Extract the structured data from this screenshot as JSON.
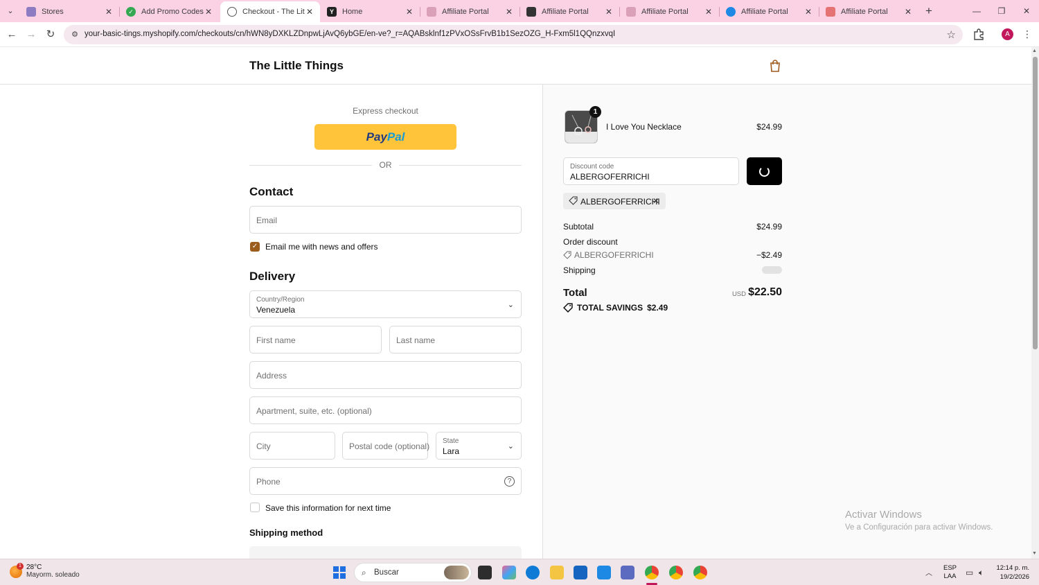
{
  "browser": {
    "tabs": [
      {
        "title": "Stores",
        "favicon": "stores-favicon",
        "color": "#8e7cc3",
        "active": false
      },
      {
        "title": "Add Promo Codes fo",
        "favicon": "promo-favicon",
        "color": "#34a853",
        "active": false
      },
      {
        "title": "Checkout - The Little",
        "favicon": "shopify-favicon",
        "color": "#555555",
        "active": true
      },
      {
        "title": "Home",
        "favicon": "y-favicon",
        "color": "#222222",
        "active": false
      },
      {
        "title": "Affiliate Portal",
        "favicon": "affiliate-favicon-1",
        "color": "#d9a0b8",
        "active": false
      },
      {
        "title": "Affiliate Portal",
        "favicon": "affiliate-favicon-2",
        "color": "#333333",
        "active": false
      },
      {
        "title": "Affiliate Portal",
        "favicon": "affiliate-favicon-3",
        "color": "#d9a0b8",
        "active": false
      },
      {
        "title": "Affiliate Portal",
        "favicon": "affiliate-favicon-4",
        "color": "#1e88e5",
        "active": false
      },
      {
        "title": "Affiliate Portal",
        "favicon": "affiliate-favicon-5",
        "color": "#e57373",
        "active": false
      }
    ],
    "url": "your-basic-tings.myshopify.com/checkouts/cn/hWN8yDXKLZDnpwLjAvQ6ybGE/en-ve?_r=AQABsklnf1zPVxOSsFrvB1b1SezOZG_H-Fxm5l1QQnzxvqI",
    "profile_initial": "A"
  },
  "store": {
    "name": "The Little Things"
  },
  "checkout": {
    "express_label": "Express checkout",
    "paypal_pay": "Pay",
    "paypal_pal": "Pal",
    "or_label": "OR",
    "contact_title": "Contact",
    "email_placeholder": "Email",
    "news_checkbox_label": "Email me with news and offers",
    "news_checkbox_checked": true,
    "delivery_title": "Delivery",
    "country_label": "Country/Region",
    "country_value": "Venezuela",
    "first_name_placeholder": "First name",
    "last_name_placeholder": "Last name",
    "address_placeholder": "Address",
    "apartment_placeholder": "Apartment, suite, etc. (optional)",
    "city_placeholder": "City",
    "postal_placeholder": "Postal code (optional)",
    "state_label": "State",
    "state_value": "Lara",
    "phone_placeholder": "Phone",
    "save_info_label": "Save this information for next time",
    "save_info_checked": false,
    "shipping_method_title": "Shipping method"
  },
  "summary": {
    "product": {
      "name": "I Love You Necklace",
      "price": "$24.99",
      "quantity": "1"
    },
    "discount_label": "Discount code",
    "discount_value": "ALBERGOFERRICHI",
    "applied_code": "ALBERGOFERRICHI",
    "subtotal_label": "Subtotal",
    "subtotal_value": "$24.99",
    "order_discount_label": "Order discount",
    "order_discount_code": "ALBERGOFERRICHI",
    "order_discount_value": "−$2.49",
    "shipping_label": "Shipping",
    "total_label": "Total",
    "total_currency": "USD",
    "total_value": "$22.50",
    "savings_label": "TOTAL SAVINGS",
    "savings_value": "$2.49"
  },
  "watermark": {
    "line1": "Activar Windows",
    "line2": "Ve a Configuración para activar Windows."
  },
  "taskbar": {
    "weather_temp": "28°C",
    "weather_desc": "Mayorm. soleado",
    "weather_badge": "1",
    "search_text": "Buscar",
    "lang_top": "ESP",
    "lang_bottom": "LAA",
    "time": "12:14 p. m.",
    "date": "19/2/2026"
  }
}
